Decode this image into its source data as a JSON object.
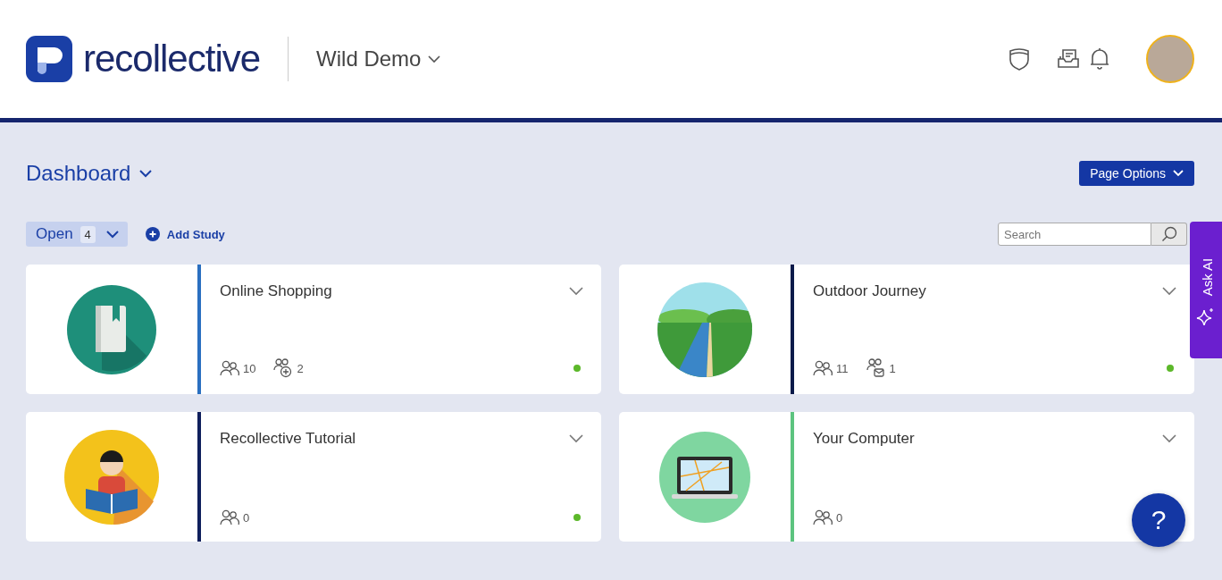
{
  "header": {
    "logo_text": "recollective",
    "workspace": "Wild Demo"
  },
  "page": {
    "title": "Dashboard",
    "page_options": "Page Options"
  },
  "toolbar": {
    "filter_label": "Open",
    "filter_count": "4",
    "add_study": "Add Study",
    "search": {
      "placeholder": "Search"
    }
  },
  "studies": [
    {
      "title": "Online Shopping",
      "kind": "book",
      "color": "#2a6fc0",
      "stats": [
        {
          "kind": "members",
          "value": "10"
        },
        {
          "kind": "invited",
          "value": "2"
        }
      ],
      "status_dot": true
    },
    {
      "title": "Outdoor Journey",
      "kind": "landscape",
      "color": "#0b1a4a",
      "stats": [
        {
          "kind": "members",
          "value": "11"
        },
        {
          "kind": "mail",
          "value": "1"
        }
      ],
      "status_dot": true
    },
    {
      "title": "Recollective Tutorial",
      "kind": "reader",
      "color": "#0f1f5c",
      "stats": [
        {
          "kind": "members",
          "value": "0"
        }
      ],
      "status_dot": true
    },
    {
      "title": "Your Computer",
      "kind": "laptop",
      "color": "#5cc47f",
      "stats": [
        {
          "kind": "members",
          "value": "0"
        }
      ]
    }
  ],
  "ask_ai": "Ask AI",
  "help": "?"
}
